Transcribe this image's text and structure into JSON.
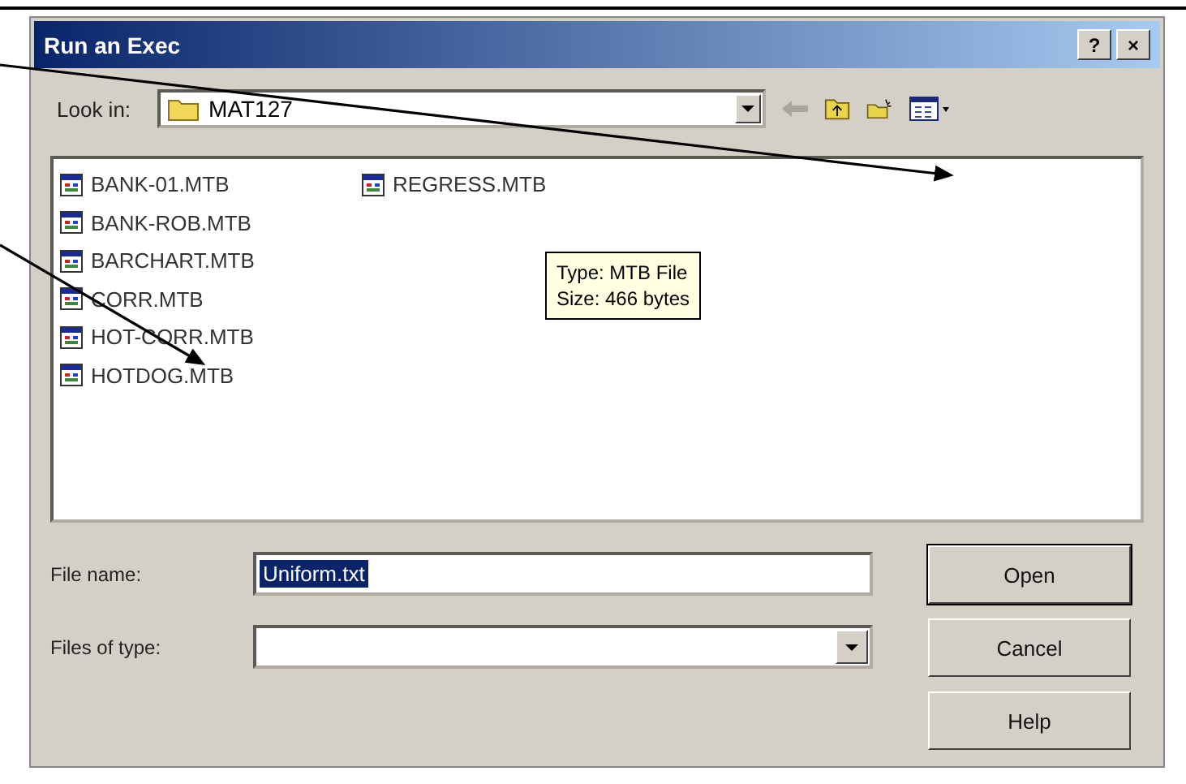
{
  "window": {
    "title": "Run an Exec",
    "title_buttons": [
      "?",
      "×"
    ]
  },
  "look_in": {
    "label": "Look in:",
    "value": "MAT127"
  },
  "files": [
    {
      "name": "BANK-01.MTB"
    },
    {
      "name": "BANK-ROB.MTB"
    },
    {
      "name": "BARCHART.MTB"
    },
    {
      "name": "CORR.MTB"
    },
    {
      "name": "HOT-CORR.MTB"
    },
    {
      "name": "HOTDOG.MTB"
    },
    {
      "name": "REGRESS.MTB"
    }
  ],
  "tooltip": {
    "lines": [
      "Type: MTB File",
      "Size: 466 bytes"
    ]
  },
  "file_name": {
    "label": "File name:",
    "value": "Uniform.txt",
    "selected": true
  },
  "file_type": {
    "label": "Files of type:"
  },
  "buttons": [
    {
      "label": "Open",
      "default": true
    },
    {
      "label": "Cancel",
      "default": false
    },
    {
      "label": "Help",
      "default": false
    }
  ]
}
